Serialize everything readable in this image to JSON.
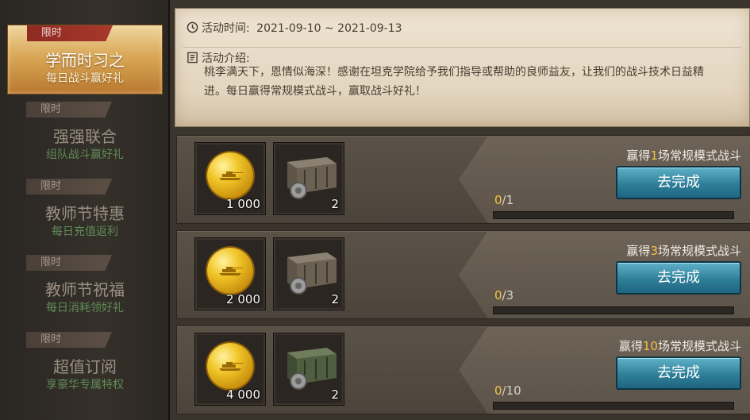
{
  "sidebar": {
    "items": [
      {
        "tag": "限时",
        "title": "学而时习之",
        "subtitle": "每日战斗赢好礼",
        "active": true
      },
      {
        "tag": "限时",
        "title": "强强联合",
        "subtitle": "组队战斗赢好礼",
        "active": false
      },
      {
        "tag": "限时",
        "title": "教师节特惠",
        "subtitle": "每日充值返利",
        "active": false
      },
      {
        "tag": "限时",
        "title": "教师节祝福",
        "subtitle": "每日消耗领好礼",
        "active": false
      },
      {
        "tag": "限时",
        "title": "超值订阅",
        "subtitle": "享豪华专属特权",
        "active": false
      }
    ]
  },
  "info": {
    "time_label": "活动时间:",
    "time_value": "2021-09-10 ~ 2021-09-13",
    "intro_label": "活动介绍:",
    "intro_text": "桃李满天下，恩情似海深！感谢在坦克学院给予我们指导或帮助的良师益友，让我们的战斗技术日益精进。每日赢得常规模式战斗，赢取战斗好礼！"
  },
  "tasks": [
    {
      "objective_pre": "赢得",
      "objective_num": "1",
      "objective_post": "场常规模式战斗",
      "reward_coin": "1 000",
      "reward_crate_qty": "2",
      "progress_current": "0",
      "progress_total": "/1",
      "progress_fraction": 0,
      "button": "去完成",
      "crate_variant": "brown"
    },
    {
      "objective_pre": "赢得",
      "objective_num": "3",
      "objective_post": "场常规模式战斗",
      "reward_coin": "2 000",
      "reward_crate_qty": "2",
      "progress_current": "0",
      "progress_total": "/3",
      "progress_fraction": 0,
      "button": "去完成",
      "crate_variant": "brown"
    },
    {
      "objective_pre": "赢得",
      "objective_num": "10",
      "objective_post": "场常规模式战斗",
      "reward_coin": "4 000",
      "reward_crate_qty": "2",
      "progress_current": "0",
      "progress_total": "/10",
      "progress_fraction": 0,
      "button": "去完成",
      "crate_variant": "green"
    }
  ],
  "icons": {
    "clock": "clock-icon",
    "list": "document-icon",
    "coin": "gold-coin-icon",
    "crate": "supply-crate-icon"
  },
  "colors": {
    "accent_gold": "#f5c343",
    "button_blue": "#2f7f99",
    "tag_red": "#a8382c",
    "active_tab": "#d9a857"
  }
}
